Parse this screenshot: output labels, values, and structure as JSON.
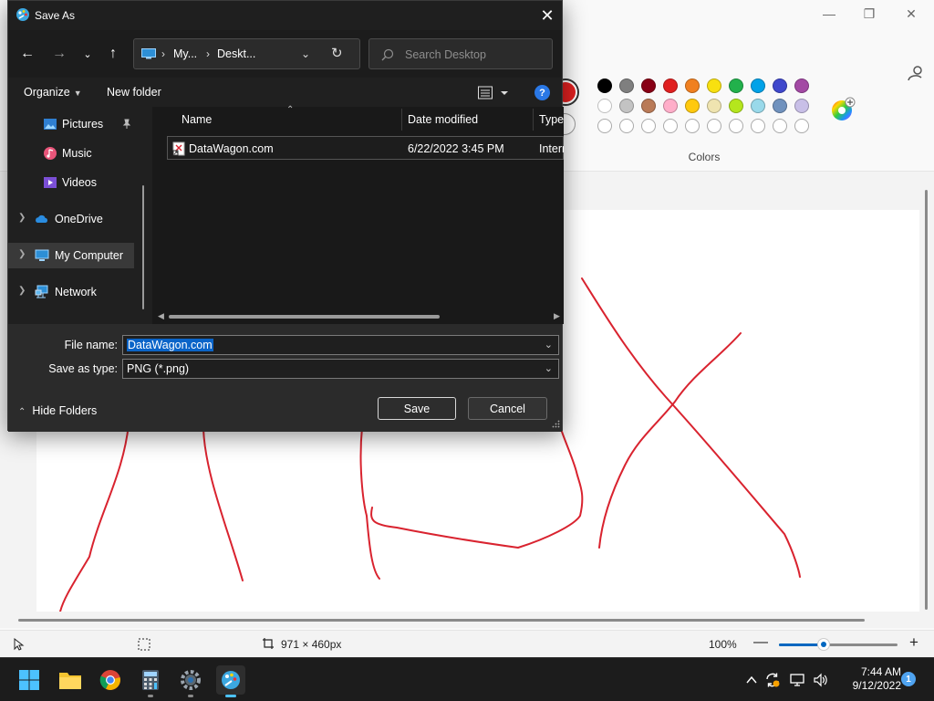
{
  "paint": {
    "colors_label": "Colors",
    "active_color": "#e02020",
    "palette_row1": [
      "#000000",
      "#7f7f7f",
      "#880015",
      "#e02020",
      "#f08020",
      "#f8e010",
      "#22b14c",
      "#00a2e8",
      "#3f48cc",
      "#a349a4"
    ],
    "palette_row2": [
      "#ffffff",
      "#c3c3c3",
      "#b97a57",
      "#ffaec9",
      "#ffc90e",
      "#efe4b0",
      "#b5e61d",
      "#99d9ea",
      "#7092be",
      "#c8bfe7"
    ],
    "canvas_size": "971 × 460px",
    "zoom_label": "100%",
    "zoom_fraction": 0.38
  },
  "dialog": {
    "title": "Save As",
    "address": {
      "crumbs": [
        "My...",
        "Deskt..."
      ]
    },
    "search_placeholder": "Search Desktop",
    "toolbar": {
      "organize": "Organize",
      "new_folder": "New folder",
      "help": "?"
    },
    "nav_items": [
      {
        "label": "Pictures",
        "icon": "pictures-icon"
      },
      {
        "label": "Music",
        "icon": "music-icon"
      },
      {
        "label": "Videos",
        "icon": "videos-icon"
      },
      {
        "label": "OneDrive",
        "icon": "onedrive-icon"
      },
      {
        "label": "My Computer",
        "icon": "computer-icon"
      },
      {
        "label": "Network",
        "icon": "network-icon"
      }
    ],
    "columns": [
      "Name",
      "Date modified",
      "Type"
    ],
    "files": [
      {
        "name": "DataWagon.com",
        "date": "6/22/2022 3:45 PM",
        "type": "Intern"
      }
    ],
    "file_name_label": "File name:",
    "file_name_value": "DataWagon.com",
    "save_type_label": "Save as type:",
    "save_type_value": "PNG (*.png)",
    "hide_folders": "Hide Folders",
    "save_button": "Save",
    "cancel_button": "Cancel"
  },
  "taskbar": {
    "apps": [
      "start-icon",
      "file-explorer-icon",
      "chrome-icon",
      "calculator-icon",
      "settings-icon",
      "paint-icon"
    ],
    "time": "7:44 AM",
    "date": "9/12/2022",
    "notification_count": "1"
  }
}
